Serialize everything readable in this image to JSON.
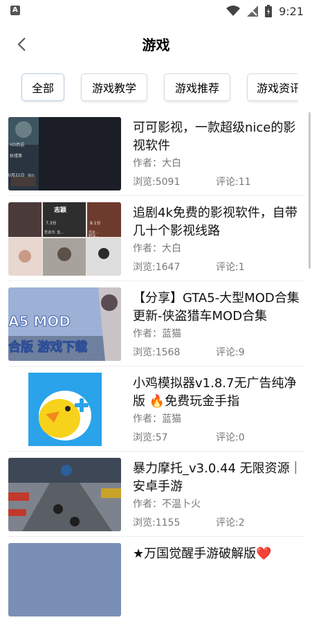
{
  "status": {
    "left_icon": "A",
    "time": "9:21",
    "icons": [
      "wifi-icon",
      "signal-icon",
      "battery-icon"
    ]
  },
  "header": {
    "title": "游戏",
    "back_icon": "chevron-left-icon"
  },
  "tabs": [
    {
      "label": "全部",
      "active": true
    },
    {
      "label": "游戏教学",
      "active": false
    },
    {
      "label": "游戏推荐",
      "active": false
    },
    {
      "label": "游戏资讯",
      "active": false
    }
  ],
  "items": [
    {
      "title": "可可影视，一款超级nice的影视软件",
      "author": "作者：大白",
      "views": "浏览:5091",
      "comments": "评论:11",
      "thumb": {
        "texts": [
          "HD西语",
          "秋瑾事",
          "0月21日",
          "播出"
        ]
      }
    },
    {
      "title": "追剧4k免费的影视软件，自带几十个影视线路",
      "author": "作者：大白",
      "views": "浏览:1647",
      "comments": "评论:1",
      "thumb": {
        "texts": [
          "志颖",
          "7.3分",
          "8.1分",
          "吾道洋: 蓝...",
          "苏乡...",
          "刺深..."
        ]
      }
    },
    {
      "title": "【分享】GTA5-大型MOD合集更新-侠盗猎车MOD合集",
      "author": "作者：蓝猫",
      "views": "浏览:1568",
      "comments": "评论:9",
      "thumb": {
        "texts": [
          "A5 MOD",
          "合版 游戏下载"
        ]
      }
    },
    {
      "title": "小鸡模拟器v1.8.7无广告纯净版 🔥免费玩金手指",
      "author": "作者：蓝猫",
      "views": "浏览:57",
      "comments": "评论:0",
      "thumb": {
        "texts": []
      }
    },
    {
      "title": "暴力摩托_v3.0.44 无限资源｜安卓手游",
      "author": "作者：不温卜火",
      "views": "浏览:1155",
      "comments": "评论:2",
      "thumb": {
        "texts": []
      }
    },
    {
      "title": "★万国觉醒手游破解版❤️",
      "author": "",
      "views": "",
      "comments": "",
      "thumb": {
        "texts": []
      }
    }
  ],
  "colors": {
    "tab_border": "#d9d9d9",
    "meta_text": "#777777",
    "title_text": "#111111"
  }
}
